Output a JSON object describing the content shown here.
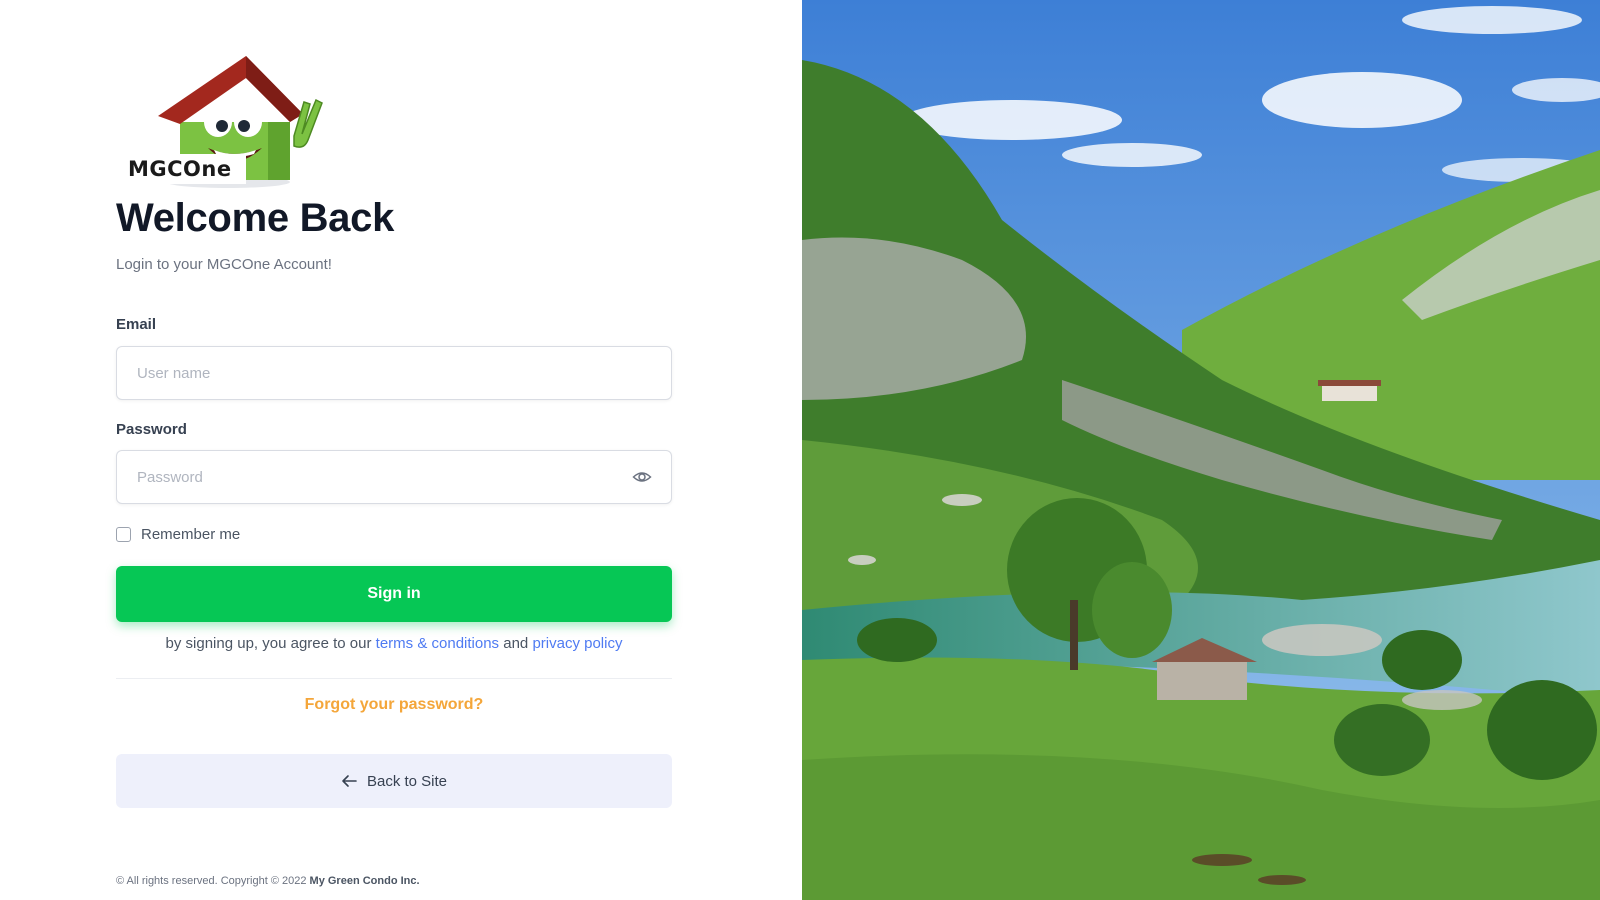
{
  "brand": {
    "logo_text": "MGCOne"
  },
  "header": {
    "title": "Welcome Back",
    "subtitle": "Login to your MGCOne Account!"
  },
  "form": {
    "email_label": "Email",
    "email_placeholder": "User name",
    "email_value": "",
    "password_label": "Password",
    "password_placeholder": "Password",
    "password_value": "",
    "remember_label": "Remember me",
    "remember_checked": false,
    "signin_label": "Sign in"
  },
  "agreement": {
    "prefix": "by signing up, you agree to our",
    "terms_link": "terms & conditions",
    "and": "and",
    "privacy_link": "privacy policy"
  },
  "links": {
    "forgot_password": "Forgot your password?",
    "back_to_site": "Back to Site"
  },
  "footer": {
    "prefix": "© All rights reserved. Copyright © 2022",
    "company": "My Green Condo Inc."
  },
  "icons": {
    "eye": "eye-icon",
    "back_arrow": "arrow-left-icon",
    "mascot": "house-mascot-icon"
  },
  "colors": {
    "primary_green": "#06c755",
    "link_blue": "#4f7bf2",
    "forgot_orange": "#f4a63a",
    "back_button_bg": "#eef0fb"
  }
}
